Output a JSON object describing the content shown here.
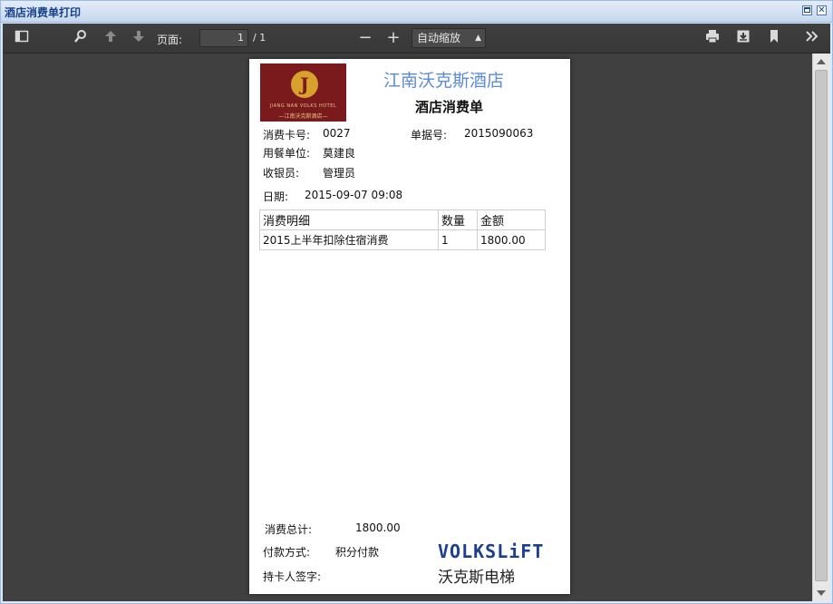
{
  "window": {
    "title": "酒店消费单打印",
    "close_glyph": "✕"
  },
  "toolbar": {
    "page_label": "页面:",
    "page_current": "1",
    "page_total": "/ 1",
    "zoom_out": "−",
    "zoom_in": "+",
    "zoom_value": "自动缩放",
    "icons": [
      "sidebar-toggle-icon",
      "search-icon",
      "previous-page-icon",
      "next-page-icon",
      "zoom-out-icon",
      "zoom-in-icon",
      "print-icon",
      "download-icon",
      "bookmark-icon",
      "tools-icon"
    ]
  },
  "receipt": {
    "logo": {
      "letter": "J",
      "en": "JIANG NAN VOLKS HOTEL",
      "cn": "—江南沃克斯酒店—"
    },
    "hotel_name": "江南沃克斯酒店",
    "title": "酒店消费单",
    "card_label": "消费卡号:",
    "card_no": "0027",
    "bill_label": "单据号:",
    "bill_no": "2015090063",
    "unit_label": "用餐单位:",
    "unit": "莫建良",
    "cashier_label": "收银员:",
    "cashier": "管理员",
    "date_label": "日期:",
    "date": "2015-09-07 09:08",
    "table": {
      "headers": [
        "消费明细",
        "数量",
        "金额"
      ],
      "rows": [
        [
          "2015上半年扣除住宿消费",
          "1",
          "1800.00"
        ]
      ]
    },
    "total_label": "消费总计:",
    "total": "1800.00",
    "payment_label": "付款方式:",
    "payment": "积分付款",
    "signature_label": "持卡人签字:",
    "brand_en": "VOLKSLiFT",
    "brand_cn": "沃克斯电梯"
  }
}
